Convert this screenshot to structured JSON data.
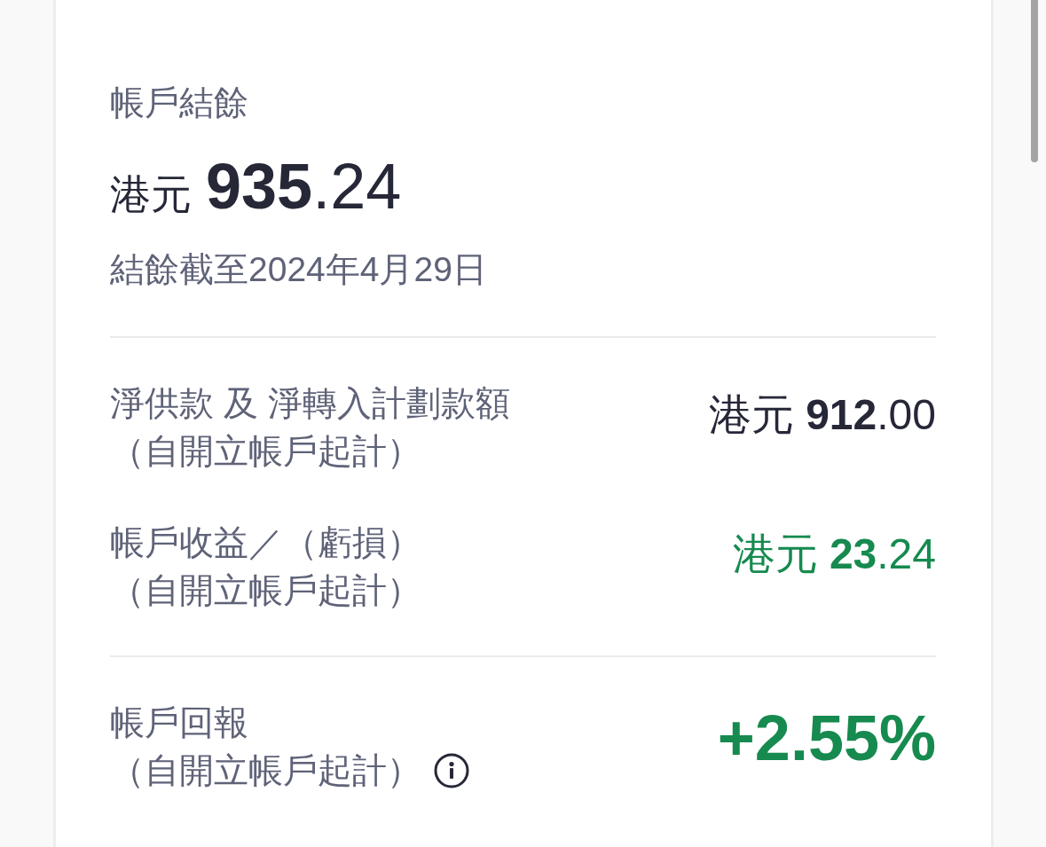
{
  "balance": {
    "label": "帳戶結餘",
    "currency": "港元",
    "amount": "**935**.24",
    "as_of": "結餘截至2024年4月29日"
  },
  "details": [
    {
      "label": "淨供款 及 淨轉入計劃款額",
      "note": "（自開立帳戶起計）",
      "amount": "港元 **912**.00",
      "color": "#262838"
    },
    {
      "label": "帳戶收益／（虧損）",
      "note": "（自開立帳戶起計）",
      "amount": "港元 **23**.24",
      "color": "#168a4f"
    }
  ],
  "account_return": {
    "label": "帳戶回報",
    "note": "（自開立帳戶起計）",
    "value": "+2.55%",
    "positive": true
  }
}
